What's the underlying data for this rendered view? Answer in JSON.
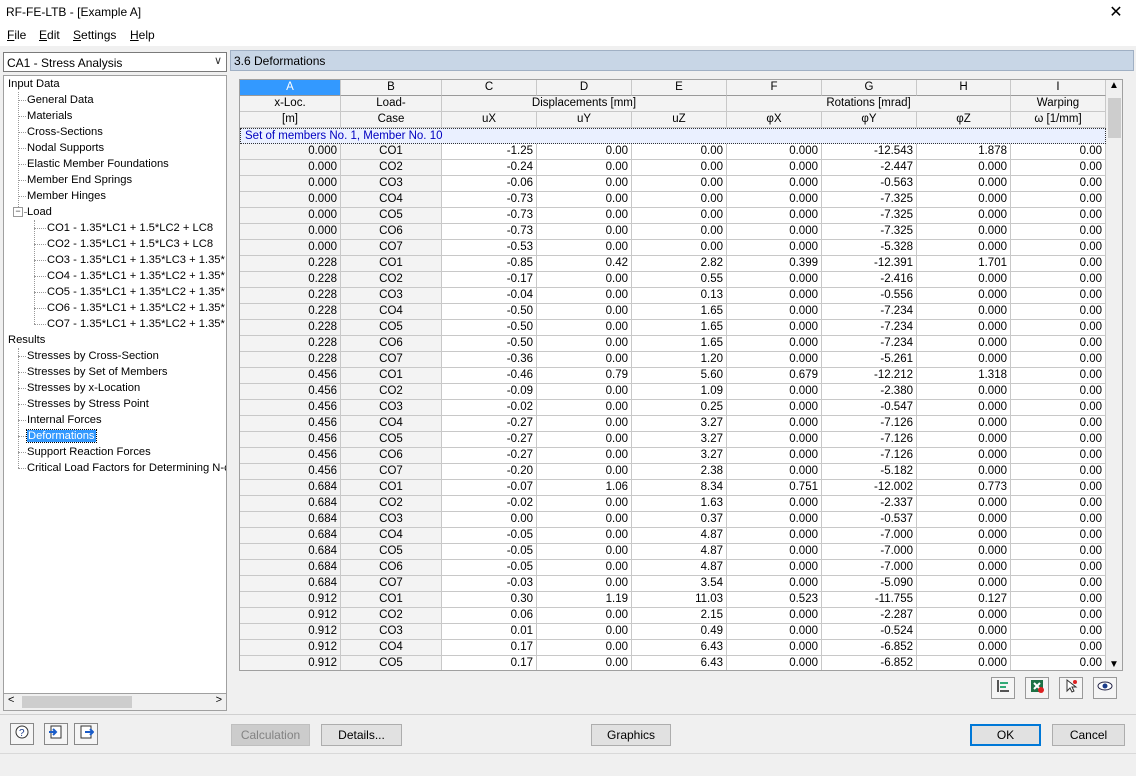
{
  "window": {
    "title": "RF-FE-LTB - [Example A]",
    "close": "✕"
  },
  "menu": [
    {
      "pre": "",
      "ul": "F",
      "post": "ile"
    },
    {
      "pre": "",
      "ul": "E",
      "post": "dit"
    },
    {
      "pre": "",
      "ul": "S",
      "post": "ettings"
    },
    {
      "pre": "",
      "ul": "H",
      "post": "elp"
    }
  ],
  "case_select": {
    "value": "CA1 - Stress Analysis",
    "arrow": "∨"
  },
  "tree": {
    "input_data": "Input Data",
    "input_items": [
      "General Data",
      "Materials",
      "Cross-Sections",
      "Nodal Supports",
      "Elastic Member Foundations",
      "Member End Springs",
      "Member Hinges"
    ],
    "load": "Load",
    "load_expander": "−",
    "load_items": [
      "CO1 - 1.35*LC1 + 1.5*LC2 + LC8",
      "CO2 - 1.35*LC1 + 1.5*LC3 + LC8",
      "CO3 - 1.35*LC1 + 1.35*LC3 + 1.35*",
      "CO4 - 1.35*LC1 + 1.35*LC2 + 1.35*",
      "CO5 - 1.35*LC1 + 1.35*LC2 + 1.35*",
      "CO6 - 1.35*LC1 + 1.35*LC2 + 1.35*",
      "CO7 - 1.35*LC1 + 1.35*LC2 + 1.35*"
    ],
    "results": "Results",
    "result_items": [
      "Stresses by Cross-Section",
      "Stresses by Set of Members",
      "Stresses by x-Location",
      "Stresses by Stress Point",
      "Internal Forces",
      "Deformations",
      "Support Reaction Forces",
      "Critical Load Factors for Determining N-cr"
    ],
    "selected": "Deformations",
    "scroll_left": "<",
    "scroll_right": ">"
  },
  "section_title": "3.6 Deformations",
  "table": {
    "col_letters": [
      "A",
      "B",
      "C",
      "D",
      "E",
      "F",
      "G",
      "H",
      "I"
    ],
    "header_top": [
      "x-Loc.",
      "Load-",
      "Displacements [mm]",
      "Rotations [mrad]",
      "Warping"
    ],
    "header_bottom": [
      "[m]",
      "Case",
      "uX",
      "uY",
      "uZ",
      "φX",
      "φY",
      "φZ",
      "ω [1/mm]"
    ],
    "set_label": "Set of members No. 1, Member No. 10",
    "rows": [
      [
        "0.000",
        "CO1",
        "-1.25",
        "0.00",
        "0.00",
        "0.000",
        "-12.543",
        "1.878",
        "0.00"
      ],
      [
        "0.000",
        "CO2",
        "-0.24",
        "0.00",
        "0.00",
        "0.000",
        "-2.447",
        "0.000",
        "0.00"
      ],
      [
        "0.000",
        "CO3",
        "-0.06",
        "0.00",
        "0.00",
        "0.000",
        "-0.563",
        "0.000",
        "0.00"
      ],
      [
        "0.000",
        "CO4",
        "-0.73",
        "0.00",
        "0.00",
        "0.000",
        "-7.325",
        "0.000",
        "0.00"
      ],
      [
        "0.000",
        "CO5",
        "-0.73",
        "0.00",
        "0.00",
        "0.000",
        "-7.325",
        "0.000",
        "0.00"
      ],
      [
        "0.000",
        "CO6",
        "-0.73",
        "0.00",
        "0.00",
        "0.000",
        "-7.325",
        "0.000",
        "0.00"
      ],
      [
        "0.000",
        "CO7",
        "-0.53",
        "0.00",
        "0.00",
        "0.000",
        "-5.328",
        "0.000",
        "0.00"
      ],
      [
        "0.228",
        "CO1",
        "-0.85",
        "0.42",
        "2.82",
        "0.399",
        "-12.391",
        "1.701",
        "0.00"
      ],
      [
        "0.228",
        "CO2",
        "-0.17",
        "0.00",
        "0.55",
        "0.000",
        "-2.416",
        "0.000",
        "0.00"
      ],
      [
        "0.228",
        "CO3",
        "-0.04",
        "0.00",
        "0.13",
        "0.000",
        "-0.556",
        "0.000",
        "0.00"
      ],
      [
        "0.228",
        "CO4",
        "-0.50",
        "0.00",
        "1.65",
        "0.000",
        "-7.234",
        "0.000",
        "0.00"
      ],
      [
        "0.228",
        "CO5",
        "-0.50",
        "0.00",
        "1.65",
        "0.000",
        "-7.234",
        "0.000",
        "0.00"
      ],
      [
        "0.228",
        "CO6",
        "-0.50",
        "0.00",
        "1.65",
        "0.000",
        "-7.234",
        "0.000",
        "0.00"
      ],
      [
        "0.228",
        "CO7",
        "-0.36",
        "0.00",
        "1.20",
        "0.000",
        "-5.261",
        "0.000",
        "0.00"
      ],
      [
        "0.456",
        "CO1",
        "-0.46",
        "0.79",
        "5.60",
        "0.679",
        "-12.212",
        "1.318",
        "0.00"
      ],
      [
        "0.456",
        "CO2",
        "-0.09",
        "0.00",
        "1.09",
        "0.000",
        "-2.380",
        "0.000",
        "0.00"
      ],
      [
        "0.456",
        "CO3",
        "-0.02",
        "0.00",
        "0.25",
        "0.000",
        "-0.547",
        "0.000",
        "0.00"
      ],
      [
        "0.456",
        "CO4",
        "-0.27",
        "0.00",
        "3.27",
        "0.000",
        "-7.126",
        "0.000",
        "0.00"
      ],
      [
        "0.456",
        "CO5",
        "-0.27",
        "0.00",
        "3.27",
        "0.000",
        "-7.126",
        "0.000",
        "0.00"
      ],
      [
        "0.456",
        "CO6",
        "-0.27",
        "0.00",
        "3.27",
        "0.000",
        "-7.126",
        "0.000",
        "0.00"
      ],
      [
        "0.456",
        "CO7",
        "-0.20",
        "0.00",
        "2.38",
        "0.000",
        "-5.182",
        "0.000",
        "0.00"
      ],
      [
        "0.684",
        "CO1",
        "-0.07",
        "1.06",
        "8.34",
        "0.751",
        "-12.002",
        "0.773",
        "0.00"
      ],
      [
        "0.684",
        "CO2",
        "-0.02",
        "0.00",
        "1.63",
        "0.000",
        "-2.337",
        "0.000",
        "0.00"
      ],
      [
        "0.684",
        "CO3",
        "0.00",
        "0.00",
        "0.37",
        "0.000",
        "-0.537",
        "0.000",
        "0.00"
      ],
      [
        "0.684",
        "CO4",
        "-0.05",
        "0.00",
        "4.87",
        "0.000",
        "-7.000",
        "0.000",
        "0.00"
      ],
      [
        "0.684",
        "CO5",
        "-0.05",
        "0.00",
        "4.87",
        "0.000",
        "-7.000",
        "0.000",
        "0.00"
      ],
      [
        "0.684",
        "CO6",
        "-0.05",
        "0.00",
        "4.87",
        "0.000",
        "-7.000",
        "0.000",
        "0.00"
      ],
      [
        "0.684",
        "CO7",
        "-0.03",
        "0.00",
        "3.54",
        "0.000",
        "-5.090",
        "0.000",
        "0.00"
      ],
      [
        "0.912",
        "CO1",
        "0.30",
        "1.19",
        "11.03",
        "0.523",
        "-11.755",
        "0.127",
        "0.00"
      ],
      [
        "0.912",
        "CO2",
        "0.06",
        "0.00",
        "2.15",
        "0.000",
        "-2.287",
        "0.000",
        "0.00"
      ],
      [
        "0.912",
        "CO3",
        "0.01",
        "0.00",
        "0.49",
        "0.000",
        "-0.524",
        "0.000",
        "0.00"
      ],
      [
        "0.912",
        "CO4",
        "0.17",
        "0.00",
        "6.43",
        "0.000",
        "-6.852",
        "0.000",
        "0.00"
      ],
      [
        "0.912",
        "CO5",
        "0.17",
        "0.00",
        "6.43",
        "0.000",
        "-6.852",
        "0.000",
        "0.00"
      ]
    ]
  },
  "toolbar_icons": [
    "filter-icon",
    "excel-export-icon",
    "pointer-icon",
    "eye-icon"
  ],
  "buttons": {
    "calculation": "Calculation",
    "details": "Details...",
    "graphics": "Graphics",
    "ok": "OK",
    "cancel": "Cancel"
  },
  "bottom_icons": [
    "help-icon",
    "import-icon",
    "export-icon"
  ]
}
